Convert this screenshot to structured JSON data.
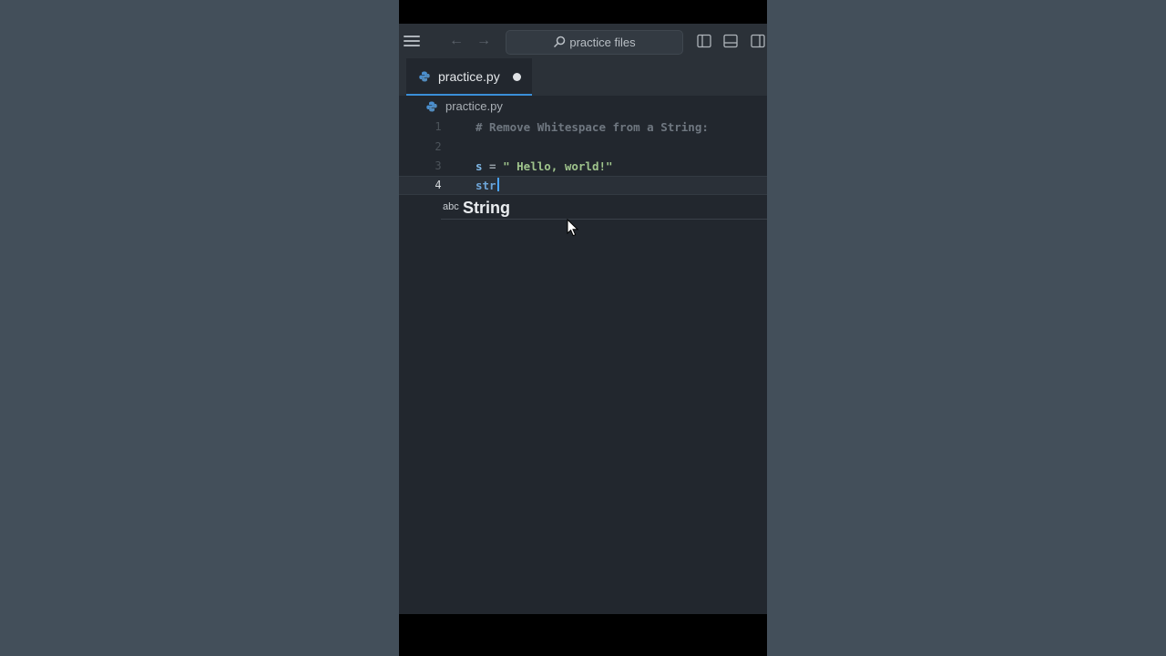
{
  "window": {
    "search_text": "practice files",
    "icons": [
      "menu-icon",
      "arrow-left-icon",
      "arrow-right-icon",
      "search-icon",
      "toggle-primary-sidebar-icon",
      "toggle-panel-icon",
      "toggle-secondary-sidebar-icon"
    ]
  },
  "tab": {
    "label": "practice.py",
    "dirty": true
  },
  "breadcrumb": {
    "label": "practice.py"
  },
  "editor": {
    "lines": [
      {
        "number": "1",
        "text": "# Remove Whitespace from a String:"
      },
      {
        "number": "2",
        "text": ""
      },
      {
        "number": "3",
        "var": "s",
        "op": " = ",
        "str": "\" Hello, world!\""
      },
      {
        "number": "4",
        "typed": "str"
      }
    ]
  },
  "suggestion": {
    "kind": "abc",
    "label": "String"
  },
  "colors": {
    "accent": "#3a8fd8",
    "editor_bg": "#22272e",
    "string": "#9fc48c",
    "variable": "#7fb7e6"
  }
}
